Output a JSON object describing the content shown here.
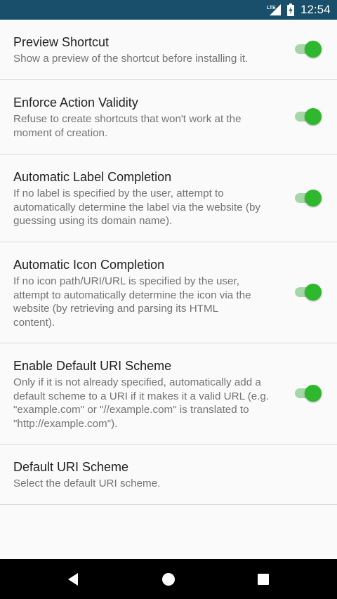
{
  "status_bar": {
    "network_label": "LTE",
    "time": "12:54",
    "icons": [
      "lte-signal-icon",
      "battery-charging-icon"
    ],
    "background": "#1a4f6b"
  },
  "preferences": [
    {
      "title": "Preview Shortcut",
      "summary": "Show a preview of the shortcut before installing it.",
      "switch_on": true
    },
    {
      "title": "Enforce Action Validity",
      "summary": "Refuse to create shortcuts that won't work at the moment of creation.",
      "switch_on": true
    },
    {
      "title": "Automatic Label Completion",
      "summary": "If no label is specified by the user, attempt to automatically determine the label via the website (by guessing using its domain name).",
      "switch_on": true
    },
    {
      "title": "Automatic Icon Completion",
      "summary": "If no icon path/URI/URL is specified by the user, attempt to automatically determine the icon via the website (by retrieving and parsing its HTML content).",
      "switch_on": true
    },
    {
      "title": "Enable Default URI Scheme",
      "summary": "Only if it is not already specified, automatically add a default scheme to a URI if it makes it a valid URL (e.g. \"example.com\" or \"//example.com\" is translated to \"http://example.com\").",
      "switch_on": true
    },
    {
      "title": "Default URI Scheme",
      "summary": "Select the default URI scheme."
    }
  ],
  "colors": {
    "switch_thumb": "#2eb82e",
    "switch_track": "#a5d6a7",
    "title_text": "#212121",
    "summary_text": "#737373"
  },
  "nav_bar": {
    "icons": [
      "back-icon",
      "home-icon",
      "recents-icon"
    ]
  }
}
